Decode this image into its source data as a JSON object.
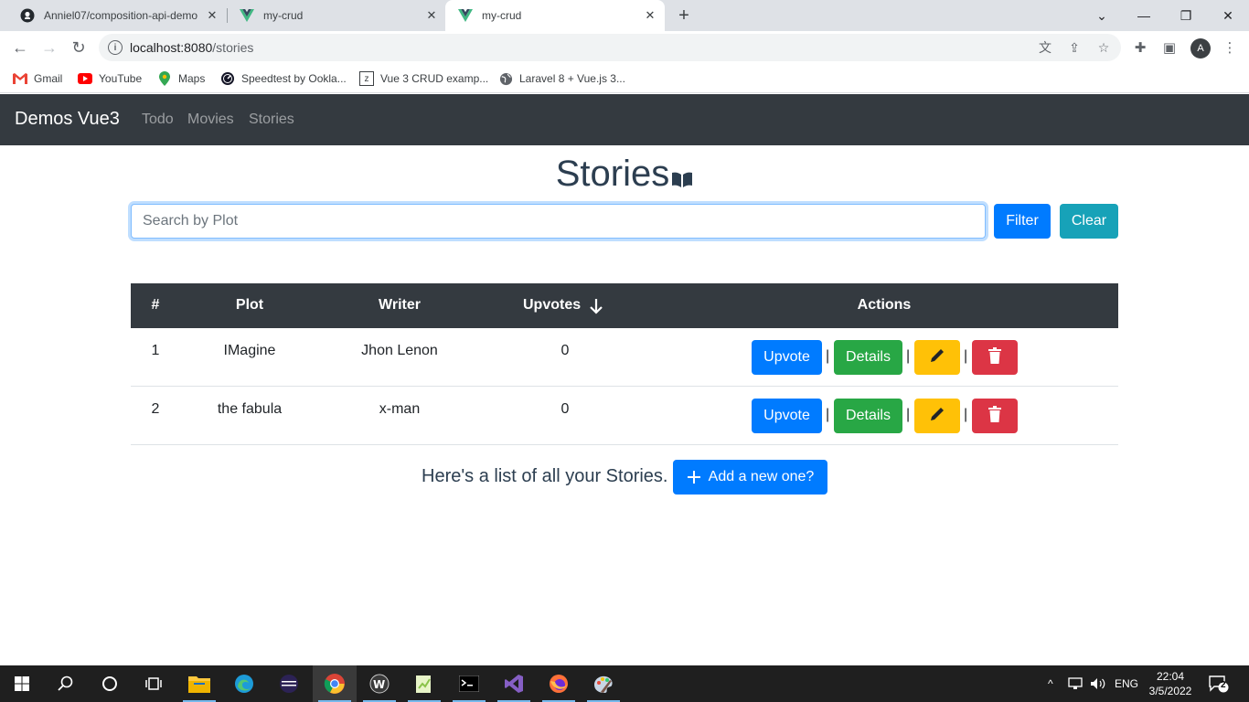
{
  "browser": {
    "tabs": [
      {
        "title": "Anniel07/composition-api-demo",
        "icon": "github-icon",
        "active": false
      },
      {
        "title": "my-crud",
        "icon": "vue-icon",
        "active": false
      },
      {
        "title": "my-crud",
        "icon": "vue-icon",
        "active": true
      }
    ],
    "url_host": "localhost:8080",
    "url_path": "/stories",
    "avatar_letter": "A",
    "bookmarks": [
      {
        "label": "Gmail",
        "icon": "gmail-icon"
      },
      {
        "label": "YouTube",
        "icon": "youtube-icon"
      },
      {
        "label": "Maps",
        "icon": "maps-icon"
      },
      {
        "label": "Speedtest by Ookla...",
        "icon": "speedtest-icon"
      },
      {
        "label": "Vue 3 CRUD examp...",
        "icon": "bookmark-z-icon"
      },
      {
        "label": "Laravel 8 + Vue.js 3...",
        "icon": "globe-icon"
      }
    ]
  },
  "app": {
    "brand": "Demos Vue3",
    "nav": [
      "Todo",
      "Movies",
      "Stories"
    ],
    "heading": "Stories",
    "search": {
      "placeholder": "Search by Plot",
      "value": ""
    },
    "filter_label": "Filter",
    "clear_label": "Clear",
    "table": {
      "headers": [
        "#",
        "Plot",
        "Writer",
        "Upvotes",
        "Actions"
      ],
      "sort_indicator": "arrow-down-icon",
      "rows": [
        {
          "id": "1",
          "plot": "IMagine",
          "writer": "Jhon Lenon",
          "upvotes": "0"
        },
        {
          "id": "2",
          "plot": "the fabula",
          "writer": "x-man",
          "upvotes": "0"
        }
      ],
      "actions": {
        "upvote": "Upvote",
        "details": "Details",
        "separator": "|"
      }
    },
    "footer_text": "Here's a list of all your Stories.",
    "add_label": "Add a new one?"
  },
  "taskbar": {
    "lang": "ENG",
    "time": "22:04",
    "date": "3/5/2022",
    "notifications": "2"
  },
  "colors": {
    "navbar": "#343a40",
    "primary": "#007bff",
    "info": "#17a2b8",
    "success": "#28a745",
    "warning": "#ffc107",
    "danger": "#dc3545"
  }
}
